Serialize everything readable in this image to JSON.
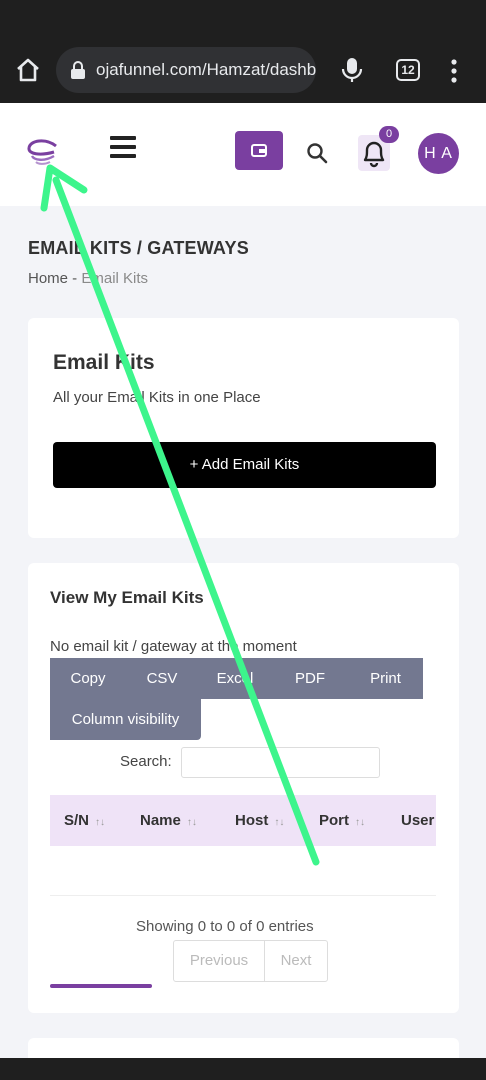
{
  "browser": {
    "url": "ojafunnel.com/Hamzat/dashb",
    "tab_count": "12"
  },
  "header": {
    "notification_count": "0",
    "avatar_initials": "H A"
  },
  "page": {
    "title": "EMAIL KITS / GATEWAYS",
    "breadcrumb_home": "Home",
    "breadcrumb_sep": " - ",
    "breadcrumb_current": "Email Kits"
  },
  "kits_card": {
    "title": "Email Kits",
    "subtitle": "All your Email Kits in one Place",
    "add_button": "+ Add Email Kits"
  },
  "table_card": {
    "title": "View My Email Kits",
    "empty_message": "No email kit / gateway at the moment",
    "buttons": {
      "copy": "Copy",
      "csv": "CSV",
      "excel": "Excel",
      "pdf": "PDF",
      "print": "Print",
      "column_visibility": "Column visibility"
    },
    "search_label": "Search:",
    "columns": [
      "S/N",
      "Name",
      "Host",
      "Port",
      "User"
    ],
    "info": "Showing 0 to 0 of 0 entries",
    "prev": "Previous",
    "next": "Next"
  },
  "colors": {
    "accent": "#7a3fa0",
    "button_gray": "#737890",
    "table_header": "#efe3f7",
    "annotation_arrow": "#3df58c"
  }
}
